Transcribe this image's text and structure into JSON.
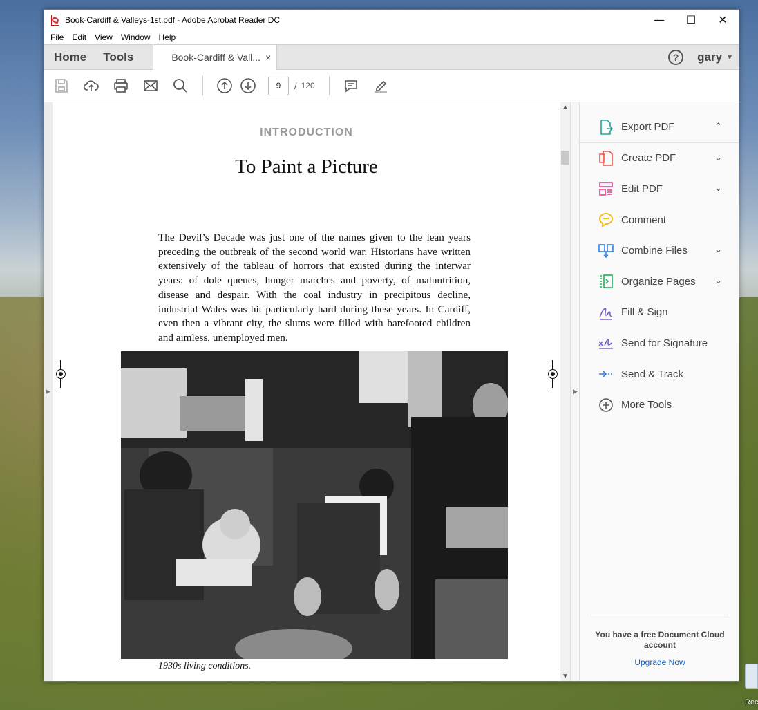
{
  "window": {
    "title": "Book-Cardiff & Valleys-1st.pdf - Adobe Acrobat Reader DC",
    "controls": {
      "minimize": "—",
      "maximize": "☐",
      "close": "✕"
    }
  },
  "menu": [
    "File",
    "Edit",
    "View",
    "Window",
    "Help"
  ],
  "tabs": {
    "home": "Home",
    "tools": "Tools",
    "document": "Book-Cardiff & Vall...",
    "close": "×"
  },
  "account": {
    "help": "?",
    "user": "gary",
    "caret": "▼"
  },
  "toolbar": {
    "icons": [
      "save-icon",
      "upload-cloud-icon",
      "print-icon",
      "email-icon",
      "search-icon",
      "prev-page-icon",
      "next-page-icon",
      "comment-icon",
      "highlight-pen-icon"
    ],
    "current_page": "9",
    "separator": "/",
    "total_pages": "120"
  },
  "document": {
    "intro_label": "INTRODUCTION",
    "chapter_title": "To Paint a Picture",
    "paragraph": "The Devil’s Decade was just one of the names given to the lean years preceding the outbreak of the second world war. Historians have written extensively of the tableau of horrors that existed during the interwar years: of dole queues, hunger marches and poverty, of malnutrition, disease and despair. With the coal industry in precipitous decline, industrial Wales was hit particularly hard during these years. In Cardiff, even then a vibrant city, the slums were filled with barefooted children and aimless, unemployed men.",
    "caption": "1930s living conditions."
  },
  "tools_panel": {
    "items": [
      {
        "label": "Export PDF",
        "chevron": "⌃",
        "icon": "export-pdf-icon",
        "color": "#26a69a"
      },
      {
        "label": "Create PDF",
        "chevron": "⌄",
        "icon": "create-pdf-icon",
        "color": "#e5574d"
      },
      {
        "label": "Edit PDF",
        "chevron": "⌄",
        "icon": "edit-pdf-icon",
        "color": "#e83e8c"
      },
      {
        "label": "Comment",
        "chevron": "",
        "icon": "comment-tool-icon",
        "color": "#f5b800"
      },
      {
        "label": "Combine Files",
        "chevron": "⌄",
        "icon": "combine-files-icon",
        "color": "#2f80ed"
      },
      {
        "label": "Organize Pages",
        "chevron": "⌄",
        "icon": "organize-pages-icon",
        "color": "#27ae60"
      },
      {
        "label": "Fill & Sign",
        "chevron": "",
        "icon": "fill-sign-icon",
        "color": "#7b61c9"
      },
      {
        "label": "Send for Signature",
        "chevron": "",
        "icon": "send-signature-icon",
        "color": "#7b61c9"
      },
      {
        "label": "Send & Track",
        "chevron": "",
        "icon": "send-track-icon",
        "color": "#2f80ed"
      },
      {
        "label": "More Tools",
        "chevron": "",
        "icon": "more-tools-icon",
        "color": "#555555"
      }
    ],
    "promo_text": "You have a free Document Cloud account",
    "promo_link": "Upgrade Now"
  },
  "desktop": {
    "recycle_label": "Recyc"
  }
}
